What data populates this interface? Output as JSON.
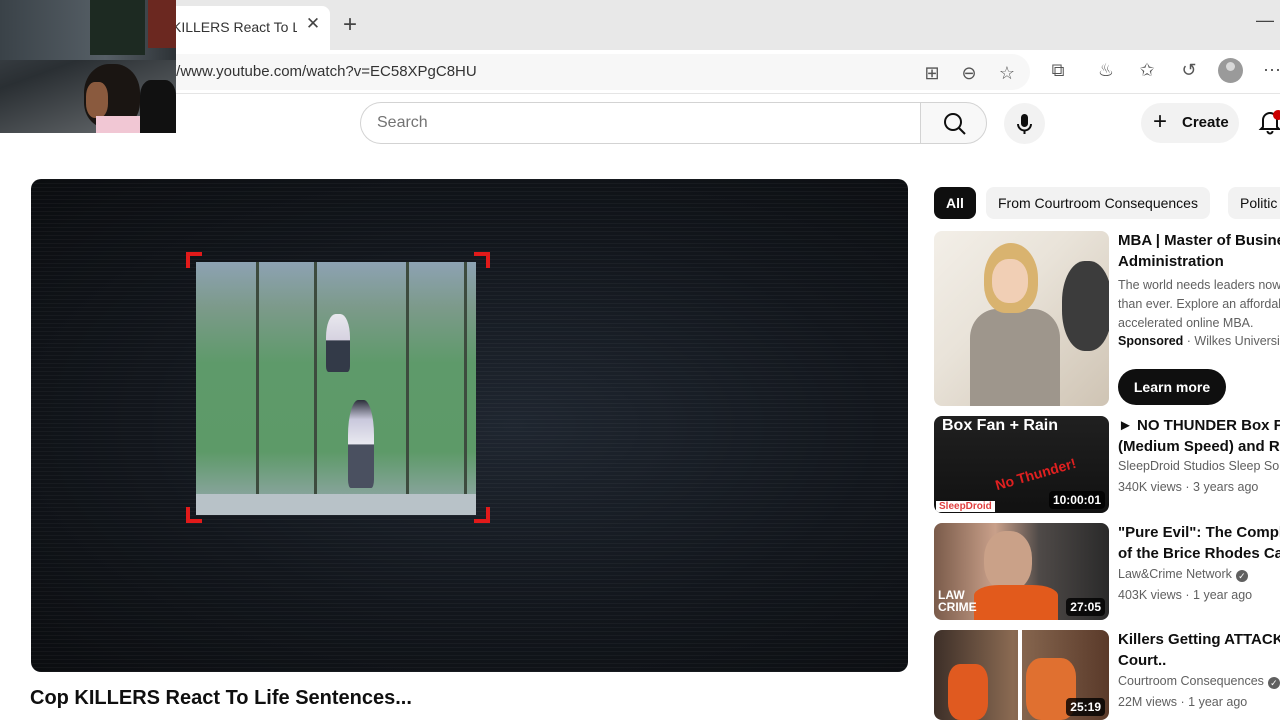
{
  "browser": {
    "tab_title": "Cop KILLERS React To Life",
    "tab_title_visible": "KILLERS React To Life",
    "url": "//www.youtube.com/watch?v=EC58XPgC8HU"
  },
  "header": {
    "search_placeholder": "Search",
    "create_label": "Create"
  },
  "video": {
    "title": "Cop KILLERS React To Life Sentences..."
  },
  "chips": [
    {
      "label": "All",
      "active": true
    },
    {
      "label": "From Courtroom Consequences",
      "active": false
    },
    {
      "label": "Politic",
      "active": false
    }
  ],
  "ad": {
    "title_line1": "MBA | Master of Busines",
    "title_line2": "Administration",
    "desc_line1": "The world needs leaders now",
    "desc_line2": "than ever. Explore an affordal",
    "desc_line3": "accelerated online MBA.",
    "sponsored": "Sponsored",
    "advertiser": " · Wilkes Universit",
    "cta": "Learn more"
  },
  "recommendations": [
    {
      "title_line1": "► NO THUNDER Box Fan",
      "title_line2": "(Medium Speed) and RA",
      "channel": "SleepDroid Studios Sleep Sou",
      "meta": "340K views · 3 years ago",
      "duration": "10:00:01",
      "thumb_text": "Box Fan + Rain",
      "thumb_accent": "No Thunder!",
      "thumb_logo": "SleepDroid"
    },
    {
      "title_line1": "\"Pure Evil\": The Complete",
      "title_line2": "of the Brice Rhodes Case",
      "channel": "Law&Crime Network",
      "meta": "403K views · 1 year ago",
      "duration": "27:05",
      "thumb_logo_line1": "LAW",
      "thumb_logo_line2": "CRIME"
    },
    {
      "title_line1": "Killers Getting ATTACKED",
      "title_line2": "Court..",
      "channel": "Courtroom Consequences",
      "meta": "22M views · 1 year ago",
      "duration": "25:19"
    }
  ],
  "colors": {
    "accent_red": "#e11a1a",
    "notification": "#cc0000",
    "chip_active": "#0f0f0f"
  }
}
